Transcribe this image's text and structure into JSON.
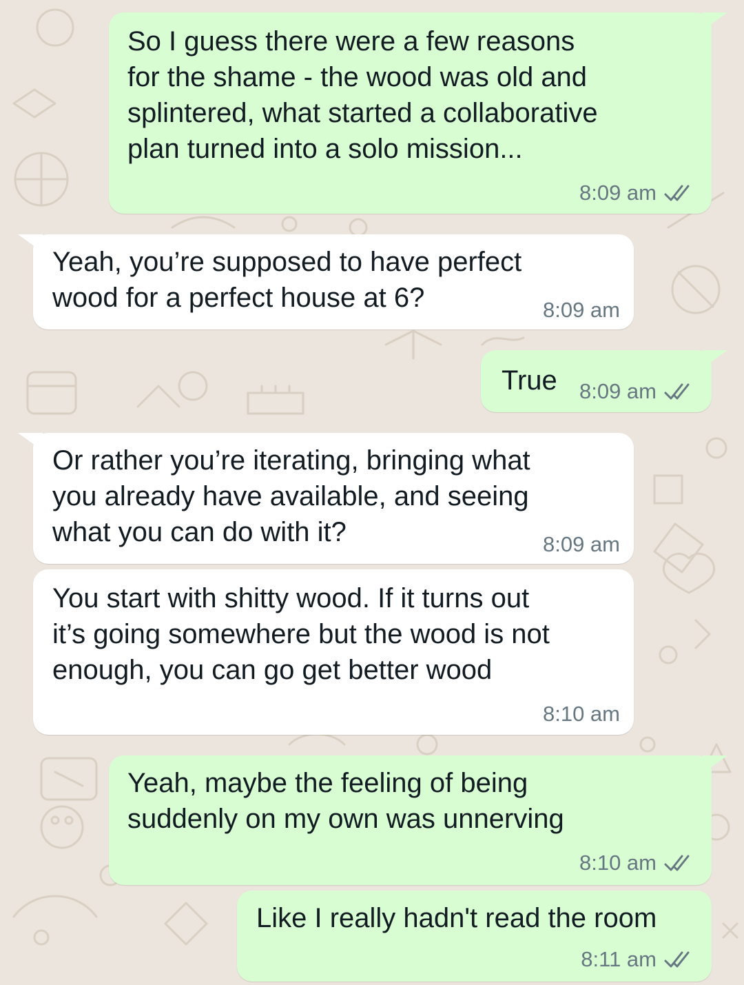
{
  "chat": {
    "colors": {
      "outgoing_bubble": "#d9fdd3",
      "incoming_bubble": "#ffffff",
      "background": "#ece5dd",
      "meta_text": "#667781",
      "ticks": "#667781"
    },
    "messages": [
      {
        "direction": "outgoing",
        "lines": [
          "So I guess there were a few reasons",
          "for the shame - the wood was old and",
          "splintered, what started a collaborative",
          "plan turned into a solo mission..."
        ],
        "time": "8:09 am",
        "status_icon": "double-check-icon"
      },
      {
        "direction": "incoming",
        "lines": [
          "Yeah, you’re supposed to have perfect",
          "wood for a perfect house at 6?"
        ],
        "time": "8:09 am"
      },
      {
        "direction": "outgoing",
        "lines": [
          "True"
        ],
        "time": "8:09 am",
        "status_icon": "double-check-icon"
      },
      {
        "direction": "incoming",
        "lines": [
          "Or rather you’re iterating, bringing what",
          "you already have available, and seeing",
          "what you can do with it?"
        ],
        "time": "8:09 am"
      },
      {
        "direction": "incoming",
        "lines": [
          "You start with shitty wood. If it turns out",
          "it’s going somewhere but the wood is not",
          "enough, you can go get better wood"
        ],
        "time": "8:10 am"
      },
      {
        "direction": "outgoing",
        "lines": [
          "Yeah, maybe the feeling of being",
          "suddenly on my own was unnerving"
        ],
        "time": "8:10 am",
        "status_icon": "double-check-icon"
      },
      {
        "direction": "outgoing",
        "lines": [
          "Like I really hadn't read the room"
        ],
        "time": "8:11 am",
        "status_icon": "double-check-icon"
      }
    ]
  }
}
